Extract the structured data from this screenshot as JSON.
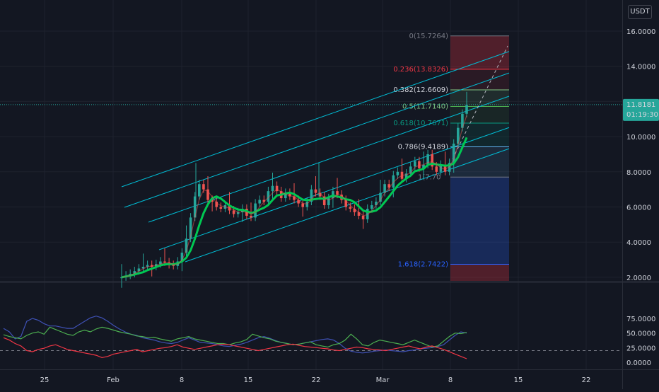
{
  "header": {
    "currency_label": "USDT"
  },
  "current_price": {
    "value": "11.8181",
    "countdown": "01:19:30",
    "bg_color": "#26a69a"
  },
  "chart_data": {
    "type": "candlestick",
    "title": "",
    "price_axis": {
      "ticks": [
        "16.0000",
        "14.0000",
        "12.0000",
        "10.0000",
        "8.0000",
        "6.0000",
        "4.0000",
        "2.0000"
      ],
      "ylim": [
        1.7,
        16.3
      ]
    },
    "time_axis": {
      "ticks": [
        "25",
        "Feb",
        "8",
        "15",
        "22",
        "Mar",
        "8",
        "15",
        "22"
      ]
    },
    "fib_levels": [
      {
        "label": "0(15.7264)",
        "value": 15.7264,
        "color": "#787b86"
      },
      {
        "label": "0.236(13.8326)",
        "value": 13.8326,
        "color": "#f23645"
      },
      {
        "label": "0.382(12.6609)",
        "value": 12.6609,
        "color": "#81c784"
      },
      {
        "label": "0.5(11.7140)",
        "value": 11.714,
        "color": "#4caf50"
      },
      {
        "label": "0.618(10.7671)",
        "value": 10.7671,
        "color": "#089981"
      },
      {
        "label": "0.786(9.4189)",
        "value": 9.4189,
        "color": "#64b5f6"
      },
      {
        "label": "1(7.7)",
        "value": 7.7,
        "color": "#787b86"
      },
      {
        "label": "1.618(2.7422)",
        "value": 2.7422,
        "color": "#2962ff"
      }
    ],
    "fib_partial_label": "1(7.70",
    "ohlc_close": [
      2.0,
      2.1,
      2.2,
      2.35,
      2.5,
      2.6,
      2.7,
      2.6,
      2.75,
      2.9,
      2.85,
      2.7,
      2.65,
      2.9,
      3.4,
      4.2,
      5.4,
      6.6,
      7.3,
      7.0,
      6.4,
      6.3,
      6.0,
      5.9,
      6.1,
      5.8,
      5.6,
      5.7,
      5.9,
      5.5,
      5.4,
      6.2,
      6.4,
      6.3,
      6.9,
      7.2,
      6.9,
      6.5,
      6.8,
      6.6,
      6.4,
      6.2,
      6.0,
      6.3,
      7.0,
      6.8,
      6.6,
      6.1,
      6.5,
      6.9,
      6.7,
      6.4,
      6.0,
      5.9,
      5.7,
      5.5,
      5.3,
      5.9,
      6.1,
      6.3,
      6.8,
      7.3,
      7.1,
      7.8,
      8.0,
      7.6,
      7.9,
      8.3,
      8.6,
      8.2,
      8.4,
      9.0,
      8.3,
      8.0,
      8.4,
      8.0,
      8.5,
      9.6,
      10.5,
      11.3,
      11.8
    ],
    "moving_averages": [
      {
        "name": "",
        "color": "#089981",
        "role": "fast"
      },
      {
        "name": "",
        "color": "#00c853",
        "role": "slow"
      }
    ],
    "oscillator": {
      "ticks": [
        "75.0000",
        "50.0000",
        "25.0000",
        "0.0000"
      ],
      "ylim": [
        -5,
        82
      ],
      "series": [
        {
          "name": "",
          "color": "#3f51b5",
          "values": [
            58,
            52,
            40,
            44,
            70,
            75,
            72,
            66,
            62,
            62,
            60,
            58,
            58,
            64,
            70,
            76,
            79,
            76,
            70,
            63,
            57,
            52,
            48,
            46,
            42,
            40,
            38,
            35,
            33,
            32,
            34,
            38,
            42,
            38,
            34,
            33,
            32,
            30,
            28,
            27,
            29,
            31,
            34,
            38,
            42,
            44,
            41,
            37,
            34,
            32,
            30,
            31,
            33,
            35,
            37,
            39,
            40,
            38,
            32,
            24,
            19,
            17,
            16,
            17,
            19,
            20,
            21,
            20,
            19,
            18,
            20,
            21,
            23,
            24,
            25,
            27,
            30,
            38,
            46,
            52,
            50
          ]
        },
        {
          "name": "",
          "color": "#4caf50",
          "values": [
            47,
            44,
            42,
            40,
            46,
            50,
            52,
            48,
            60,
            56,
            52,
            48,
            46,
            52,
            55,
            52,
            57,
            60,
            58,
            55,
            52,
            50,
            48,
            45,
            44,
            42,
            43,
            40,
            38,
            36,
            40,
            42,
            44,
            40,
            38,
            36,
            34,
            32,
            32,
            30,
            33,
            35,
            39,
            48,
            45,
            42,
            40,
            36,
            34,
            32,
            30,
            31,
            33,
            35,
            30,
            28,
            26,
            30,
            32,
            38,
            48,
            40,
            30,
            28,
            34,
            38,
            36,
            34,
            32,
            30,
            34,
            38,
            34,
            30,
            26,
            28,
            36,
            44,
            50,
            49,
            51
          ]
        },
        {
          "name": "",
          "color": "#f23645",
          "values": [
            42,
            38,
            32,
            28,
            20,
            18,
            22,
            24,
            28,
            30,
            26,
            22,
            20,
            18,
            16,
            14,
            12,
            8,
            10,
            14,
            16,
            18,
            20,
            22,
            18,
            20,
            22,
            24,
            25,
            27,
            30,
            26,
            24,
            22,
            24,
            26,
            28,
            30,
            31,
            30,
            28,
            26,
            24,
            22,
            20,
            22,
            24,
            26,
            28,
            30,
            31,
            29,
            27,
            26,
            25,
            24,
            23,
            21,
            20,
            22,
            24,
            26,
            25,
            23,
            22,
            21,
            20,
            22,
            24,
            26,
            28,
            25,
            23,
            26,
            28,
            25,
            22,
            18,
            14,
            10,
            6
          ]
        }
      ]
    }
  }
}
